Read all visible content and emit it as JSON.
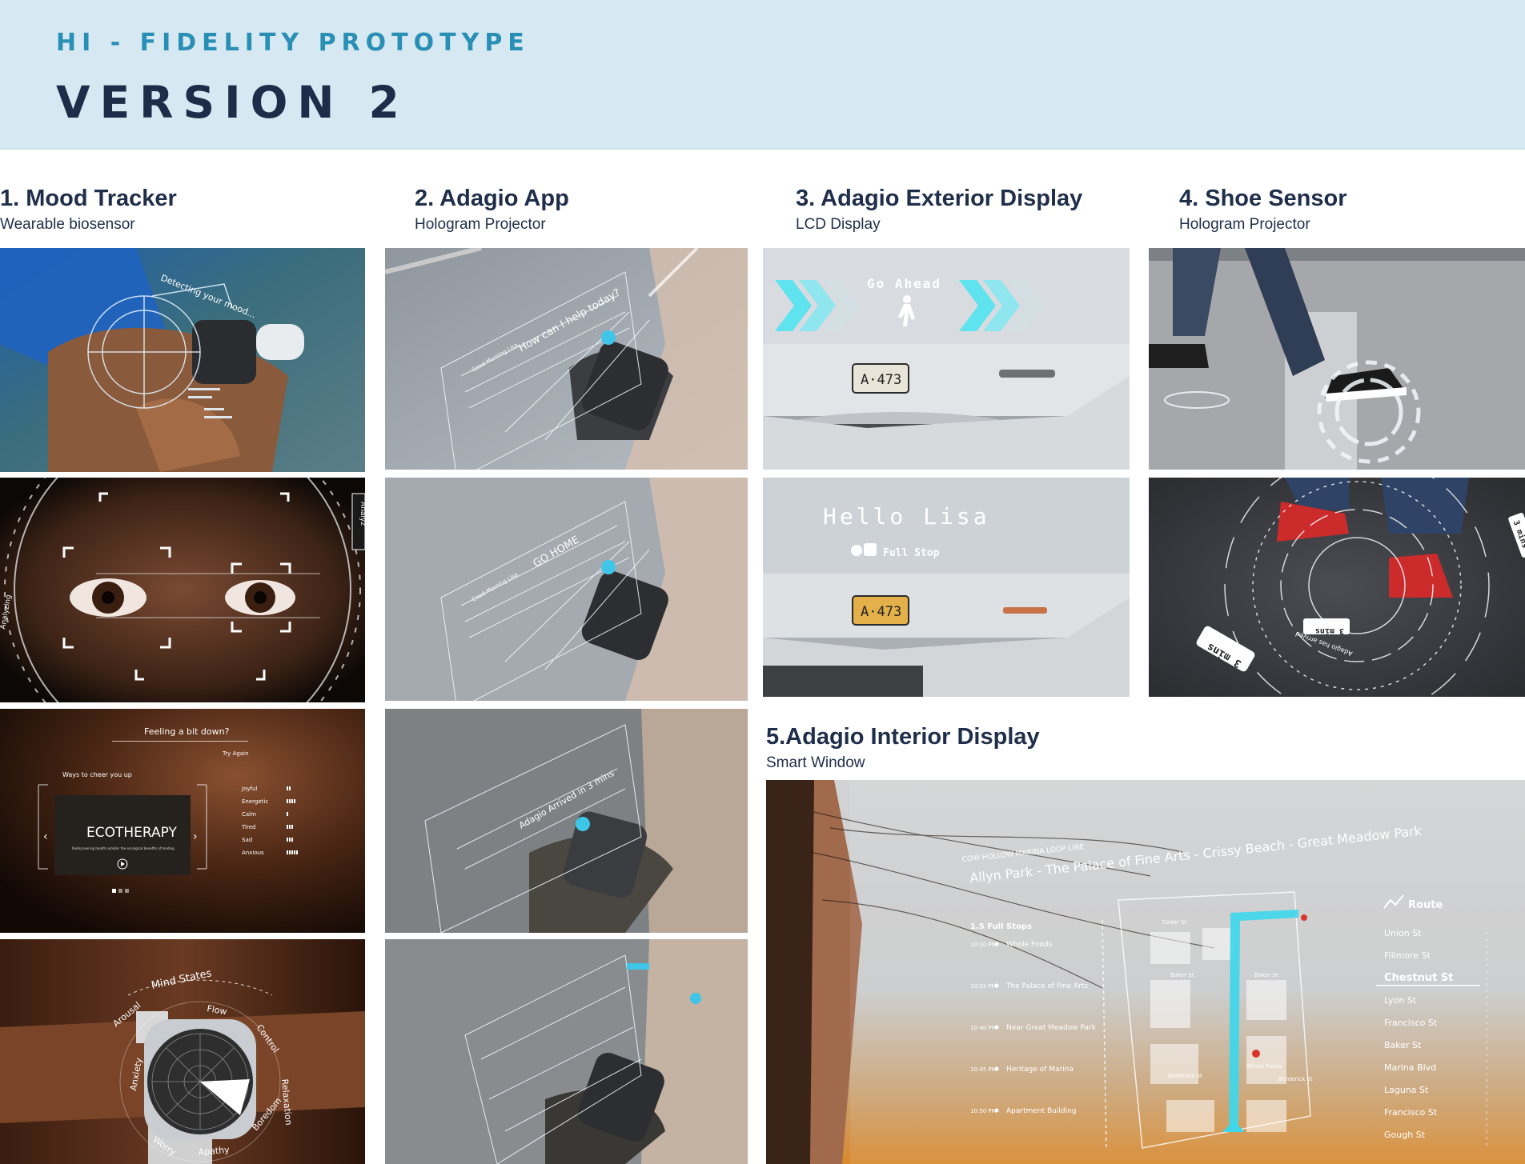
{
  "header": {
    "eyebrow": "HI - FIDELITY PROTOTYPE",
    "title": "VERSION 2"
  },
  "sections": {
    "mood": {
      "title": "1. Mood Tracker",
      "subtitle": "Wearable biosensor"
    },
    "app": {
      "title": "2. Adagio App",
      "subtitle": "Hologram Projector"
    },
    "exterior": {
      "title": "3. Adagio Exterior Display",
      "subtitle": "LCD Display"
    },
    "shoe": {
      "title": "4. Shoe Sensor",
      "subtitle": "Hologram Projector"
    },
    "interior": {
      "title": "5.Adagio Interior Display",
      "subtitle": "Smart Window"
    }
  },
  "mood_panels": {
    "p1_label": "Detecting your mood...",
    "p2_label_right": "Analyz",
    "p2_label_left": "Analyzing",
    "p3_question": "Feeling a bit down?",
    "p3_try": "Try Again",
    "p3_ways": "Ways to cheer you up",
    "p3_card": "ECOTHERAPY",
    "p3_card_sub": "Rediscovering health outside: the ecological benefits of tending",
    "p3_moods": [
      "Joyful",
      "Energetic",
      "Calm",
      "Tired",
      "Sad",
      "Anxious"
    ],
    "p4_title": "Mind States",
    "p4_states": [
      "Arousal",
      "Flow",
      "Control",
      "Relaxation",
      "Boredom",
      "Apathy",
      "Worry",
      "Anxiety"
    ]
  },
  "app_panels": {
    "p1_prompt": "How can I help today?",
    "p1_greet": "Good Morning Lisa",
    "p2_prompt": "GO HOME",
    "p2_greet": "Good Morning Lisa",
    "p3_prompt": "Adagio Arrived in 3 mins"
  },
  "exterior_panels": {
    "go_ahead": "Go Ahead",
    "plate": "A·473",
    "hello": "Hello Lisa",
    "full_stop": "Full Stop"
  },
  "shoe_panels": {
    "badge_a": "3 mins",
    "badge_b": "3 mins",
    "badge_c": "3 mins",
    "ring_text": "Adagio has arrived"
  },
  "interior": {
    "line_label": "COW HOLLOW MARINA LOOP LINE",
    "route_line": "Allyn Park - The Palace of Fine Arts - Crissy Beach - Great Meadow Park",
    "stops_header": "1.5 Full Stops",
    "stops": [
      {
        "time": "10:20 PM",
        "name": "Whole Foods"
      },
      {
        "time": "10:25 PM",
        "name": "The Palace of Fine Arts"
      },
      {
        "time": "10:40 PM",
        "name": "Near Great Meadow Park"
      },
      {
        "time": "10:45 PM",
        "name": "Heritage of Marina"
      },
      {
        "time": "10:50 PM",
        "name": "Apartment Building"
      }
    ],
    "map_labels": [
      "Cedar St",
      "Baker St",
      "Baker St",
      "Whole Foods",
      "Borderick St",
      "Borderick St"
    ],
    "route_title": "Route",
    "streets": [
      "Union St",
      "Fillmore St",
      "Chestnut St",
      "Lyon St",
      "Francisco St",
      "Baker St",
      "Marina Blvd",
      "Laguna St",
      "Francisco St",
      "Gough St"
    ],
    "active_street": "Chestnut St"
  },
  "colors": {
    "header_bg": "#d6e9f2",
    "eyebrow": "#2a8fb5",
    "heading": "#1d2c48",
    "hologram_cyan": "#5fe3ee",
    "route_blue": "#3fd7ea"
  }
}
